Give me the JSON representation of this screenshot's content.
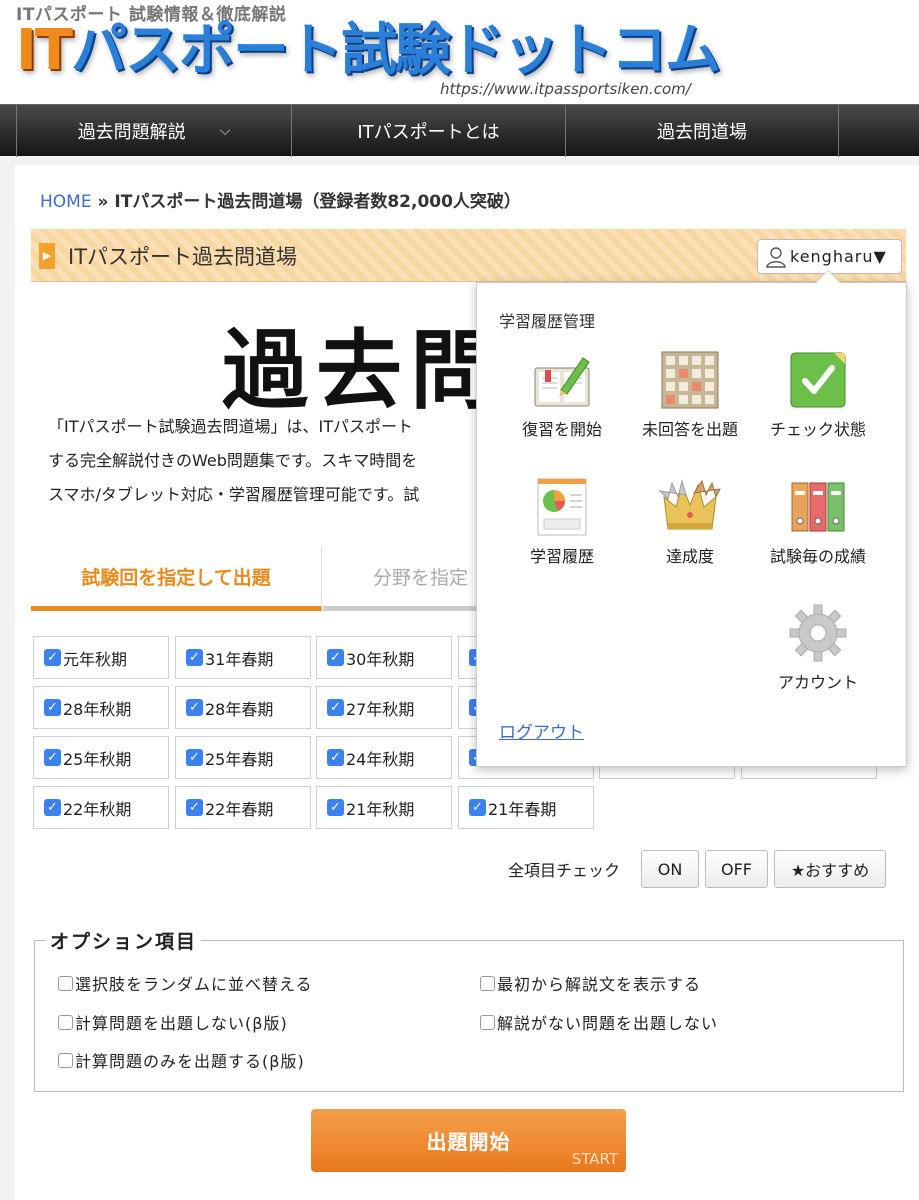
{
  "header": {
    "tagline": "ITパスポート 試験情報＆徹底解説",
    "logo_it": "IT",
    "logo_rest": "パスポート試験ドットコム",
    "url": "https://www.itpassportsiken.com/"
  },
  "nav": {
    "items": [
      {
        "label": "過去問題解説",
        "chevron": "⌵"
      },
      {
        "label": "ITパスポートとは"
      },
      {
        "label": "過去問道場"
      }
    ]
  },
  "breadcrumb": {
    "home": "HOME",
    "separator": "»",
    "current": "ITパスポート過去問道場（登録者数82,000人突破）"
  },
  "section": {
    "marker": "▶",
    "title": "ITパスポート過去問道場",
    "user_label": "kengharu▼"
  },
  "hero": {
    "title": "過去問"
  },
  "intro": {
    "lines": [
      "「ITパスポート試験過去問道場」は、ITパスポート",
      "する完全解説付きのWeb問題集です。スキマ時間を",
      "スマホ/タブレット対応・学習履歴管理可能です。試"
    ]
  },
  "tabs": {
    "active": "試験回を指定して出題",
    "inactive": "分野を指定"
  },
  "exams": {
    "rows": [
      [
        "元年秋期",
        "31年春期",
        "30年秋期"
      ],
      [
        "28年秋期",
        "28年春期",
        "27年秋期"
      ],
      [
        "25年秋期",
        "25年春期",
        "24年秋期"
      ],
      [
        "22年秋期",
        "22年春期",
        "21年秋期",
        "21年春期"
      ]
    ],
    "check_glyph": "✓"
  },
  "check_all": {
    "label": "全項目チェック",
    "on": "ON",
    "off": "OFF",
    "recommend": "★おすすめ"
  },
  "options": {
    "legend": "オプション項目",
    "items": [
      "選択肢をランダムに並べ替える",
      "最初から解説文を表示する",
      "計算問題を出題しない(β版)",
      "解説がない問題を出題しない",
      "計算問題のみを出題する(β版)"
    ]
  },
  "start": {
    "label": "出題開始",
    "sub": "START"
  },
  "dropdown": {
    "heading": "学習履歴管理",
    "items": [
      {
        "label": "復習を開始",
        "icon": "review-book-icon"
      },
      {
        "label": "未回答を出題",
        "icon": "grid-icon"
      },
      {
        "label": "チェック状態",
        "icon": "check-icon"
      },
      {
        "label": "学習履歴",
        "icon": "pie-report-icon"
      },
      {
        "label": "達成度",
        "icon": "crown-icon"
      },
      {
        "label": "試験毎の成績",
        "icon": "binders-icon"
      },
      {
        "label": "アカウント",
        "icon": "gear-icon"
      }
    ],
    "logout": "ログアウト"
  },
  "colors": {
    "accent_orange": "#e88a1d",
    "checkbox_blue": "#3b82f0",
    "link_blue": "#3d6dc2",
    "logo_blue": "#2a7fd8"
  }
}
